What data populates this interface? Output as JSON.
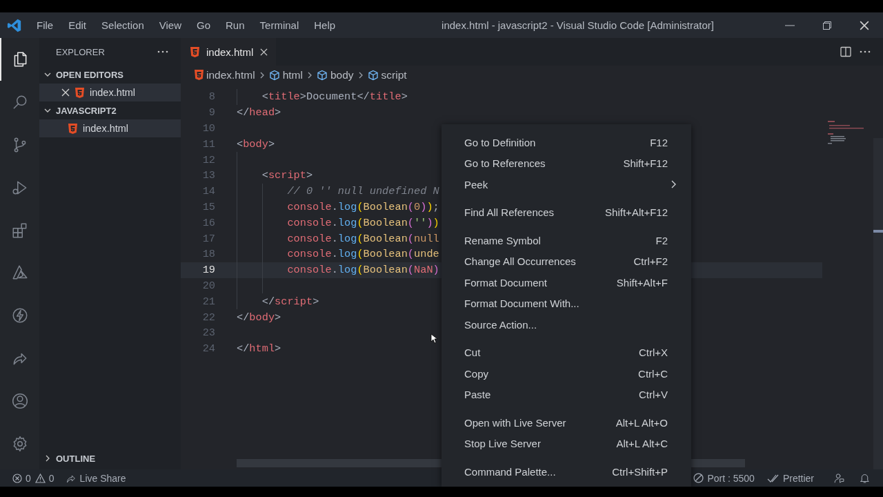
{
  "window": {
    "title": "index.html - javascript2 - Visual Studio Code [Administrator]"
  },
  "menu_bar": [
    "File",
    "Edit",
    "Selection",
    "View",
    "Go",
    "Run",
    "Terminal",
    "Help"
  ],
  "activity_bar": [
    {
      "kind": "files",
      "selected": true
    },
    {
      "kind": "search",
      "selected": false
    },
    {
      "kind": "source-control",
      "selected": false
    },
    {
      "kind": "run-debug",
      "selected": false
    },
    {
      "kind": "extensions",
      "selected": false
    },
    {
      "kind": "azure",
      "selected": false
    },
    {
      "kind": "lightning",
      "selected": false
    },
    {
      "kind": "live-share",
      "selected": false
    },
    {
      "kind": "account",
      "selected": false
    },
    {
      "kind": "settings",
      "selected": false
    }
  ],
  "sidebar": {
    "title": "EXPLORER",
    "sections": [
      {
        "title": "OPEN EDITORS",
        "expanded": true,
        "items": [
          {
            "name": "index.html",
            "selected": true,
            "closable": true
          }
        ]
      },
      {
        "title": "JAVASCRIPT2",
        "expanded": true,
        "items": [
          {
            "name": "index.html",
            "selected": true,
            "closable": false
          }
        ]
      },
      {
        "title": "OUTLINE",
        "expanded": false
      }
    ]
  },
  "tabs": [
    {
      "label": "index.html",
      "selected": true
    }
  ],
  "breadcrumb": [
    {
      "kind": "file",
      "label": "index.html"
    },
    {
      "kind": "symbol",
      "label": "html"
    },
    {
      "kind": "symbol",
      "label": "body"
    },
    {
      "kind": "symbol",
      "label": "script"
    }
  ],
  "editor": {
    "lines": [
      {
        "children": [
          {
            "number": "8",
            "current": false,
            "tokens": [
              {
                "kind": "punct",
                "text": "<"
              },
              {
                "kind": "tag",
                "text": "title"
              },
              {
                "kind": "punct",
                "text": ">"
              },
              {
                "kind": "text",
                "text": "Document"
              },
              {
                "kind": "punct",
                "text": "</"
              },
              {
                "kind": "tag",
                "text": "title"
              },
              {
                "kind": "punct",
                "text": ">"
              }
            ]
          }
        ]
      },
      {
        "number": "9",
        "current": false,
        "tokens": [
          {
            "kind": "punct",
            "text": "</"
          },
          {
            "kind": "tag",
            "text": "head"
          },
          {
            "kind": "punct",
            "text": ">"
          }
        ]
      },
      {
        "number": "10",
        "current": false
      },
      {
        "number": "11",
        "current": false,
        "tokens": [
          {
            "kind": "punct",
            "text": "<"
          },
          {
            "kind": "tag",
            "text": "body"
          },
          {
            "kind": "punct",
            "text": ">"
          }
        ],
        "children": [
          {
            "number": "12",
            "current": false
          },
          {
            "number": "13",
            "current": false,
            "tokens": [
              {
                "kind": "punct",
                "text": "<"
              },
              {
                "kind": "tag",
                "text": "script"
              },
              {
                "kind": "punct",
                "text": ">"
              }
            ],
            "children": [
              {
                "number": "14",
                "current": false,
                "tokens": [
                  {
                    "kind": "comment",
                    "text": "// 0 '' null undefined N"
                  }
                ]
              },
              {
                "number": "15",
                "current": false,
                "tokens": [
                  {
                    "kind": "variable",
                    "text": "console"
                  },
                  {
                    "kind": "punct",
                    "text": "."
                  },
                  {
                    "kind": "method",
                    "text": "log"
                  },
                  {
                    "kind": "bracket1",
                    "text": "("
                  },
                  {
                    "kind": "class",
                    "text": "Boolean"
                  },
                  {
                    "kind": "bracket2",
                    "text": "("
                  },
                  {
                    "kind": "constant",
                    "text": "0"
                  },
                  {
                    "kind": "bracket2",
                    "text": ")"
                  },
                  {
                    "kind": "bracket1",
                    "text": ")"
                  },
                  {
                    "kind": "punct",
                    "text": ";"
                  }
                ]
              },
              {
                "number": "16",
                "current": false,
                "tokens": [
                  {
                    "kind": "variable",
                    "text": "console"
                  },
                  {
                    "kind": "punct",
                    "text": "."
                  },
                  {
                    "kind": "method",
                    "text": "log"
                  },
                  {
                    "kind": "bracket1",
                    "text": "("
                  },
                  {
                    "kind": "class",
                    "text": "Boolean"
                  },
                  {
                    "kind": "bracket2",
                    "text": "("
                  },
                  {
                    "kind": "string",
                    "text": "''"
                  },
                  {
                    "kind": "bracket2",
                    "text": ")"
                  },
                  {
                    "kind": "bracket1",
                    "text": ")"
                  }
                ]
              },
              {
                "number": "17",
                "current": false,
                "tokens": [
                  {
                    "kind": "variable",
                    "text": "console"
                  },
                  {
                    "kind": "punct",
                    "text": "."
                  },
                  {
                    "kind": "method",
                    "text": "log"
                  },
                  {
                    "kind": "bracket1",
                    "text": "("
                  },
                  {
                    "kind": "class",
                    "text": "Boolean"
                  },
                  {
                    "kind": "bracket2",
                    "text": "("
                  },
                  {
                    "kind": "constant",
                    "text": "null"
                  }
                ]
              },
              {
                "number": "18",
                "current": false,
                "tokens": [
                  {
                    "kind": "variable",
                    "text": "console"
                  },
                  {
                    "kind": "punct",
                    "text": "."
                  },
                  {
                    "kind": "method",
                    "text": "log"
                  },
                  {
                    "kind": "bracket1",
                    "text": "("
                  },
                  {
                    "kind": "class",
                    "text": "Boolean"
                  },
                  {
                    "kind": "bracket2",
                    "text": "("
                  },
                  {
                    "kind": "class",
                    "text": "unde"
                  }
                ]
              },
              {
                "number": "19",
                "current": true,
                "tokens": [
                  {
                    "kind": "variable",
                    "text": "console"
                  },
                  {
                    "kind": "punct",
                    "text": "."
                  },
                  {
                    "kind": "method",
                    "text": "log"
                  },
                  {
                    "kind": "bracket1",
                    "text": "("
                  },
                  {
                    "kind": "class",
                    "text": "Boolean"
                  },
                  {
                    "kind": "bracket2",
                    "text": "("
                  },
                  {
                    "kind": "variable",
                    "text": "NaN"
                  },
                  {
                    "kind": "bracket2",
                    "text": ")"
                  }
                ]
              },
              {
                "number": "20",
                "current": false
              }
            ]
          },
          {
            "number": "21",
            "current": false,
            "tokens": [
              {
                "kind": "punct",
                "text": "</"
              },
              {
                "kind": "tag",
                "text": "script"
              },
              {
                "kind": "punct",
                "text": ">"
              }
            ]
          }
        ]
      },
      {
        "number": "22",
        "current": false,
        "tokens": [
          {
            "kind": "punct",
            "text": "</"
          },
          {
            "kind": "tag",
            "text": "body"
          },
          {
            "kind": "punct",
            "text": ">"
          }
        ]
      },
      {
        "number": "23",
        "current": false
      },
      {
        "number": "24",
        "current": false,
        "tokens": [
          {
            "kind": "punct",
            "text": "</"
          },
          {
            "kind": "tag",
            "text": "html"
          },
          {
            "kind": "punct",
            "text": ">"
          }
        ]
      }
    ]
  },
  "context_menu": {
    "groups": [
      [
        {
          "label": "Go to Definition",
          "shortcut": "F12",
          "kind": "command"
        },
        {
          "label": "Go to References",
          "shortcut": "Shift+F12",
          "kind": "command"
        },
        {
          "label": "Peek",
          "kind": "submenu"
        }
      ],
      [
        {
          "label": "Find All References",
          "shortcut": "Shift+Alt+F12",
          "kind": "command"
        }
      ],
      [
        {
          "label": "Rename Symbol",
          "shortcut": "F2",
          "kind": "command"
        },
        {
          "label": "Change All Occurrences",
          "shortcut": "Ctrl+F2",
          "kind": "command"
        },
        {
          "label": "Format Document",
          "shortcut": "Shift+Alt+F",
          "kind": "command"
        },
        {
          "label": "Format Document With...",
          "kind": "command"
        },
        {
          "label": "Source Action...",
          "kind": "command"
        }
      ],
      [
        {
          "label": "Cut",
          "shortcut": "Ctrl+X",
          "kind": "command"
        },
        {
          "label": "Copy",
          "shortcut": "Ctrl+C",
          "kind": "command"
        },
        {
          "label": "Paste",
          "shortcut": "Ctrl+V",
          "kind": "command"
        }
      ],
      [
        {
          "label": "Open with Live Server",
          "shortcut": "Alt+L Alt+O",
          "kind": "command"
        },
        {
          "label": "Stop Live Server",
          "shortcut": "Alt+L Alt+C",
          "kind": "command"
        }
      ],
      [
        {
          "label": "Command Palette...",
          "shortcut": "Ctrl+Shift+P",
          "kind": "command"
        }
      ]
    ]
  },
  "status_bar": {
    "errors": "0",
    "warnings": "0",
    "live_share": "Live Share",
    "port": "Port : 5500",
    "prettier": "Prettier"
  }
}
